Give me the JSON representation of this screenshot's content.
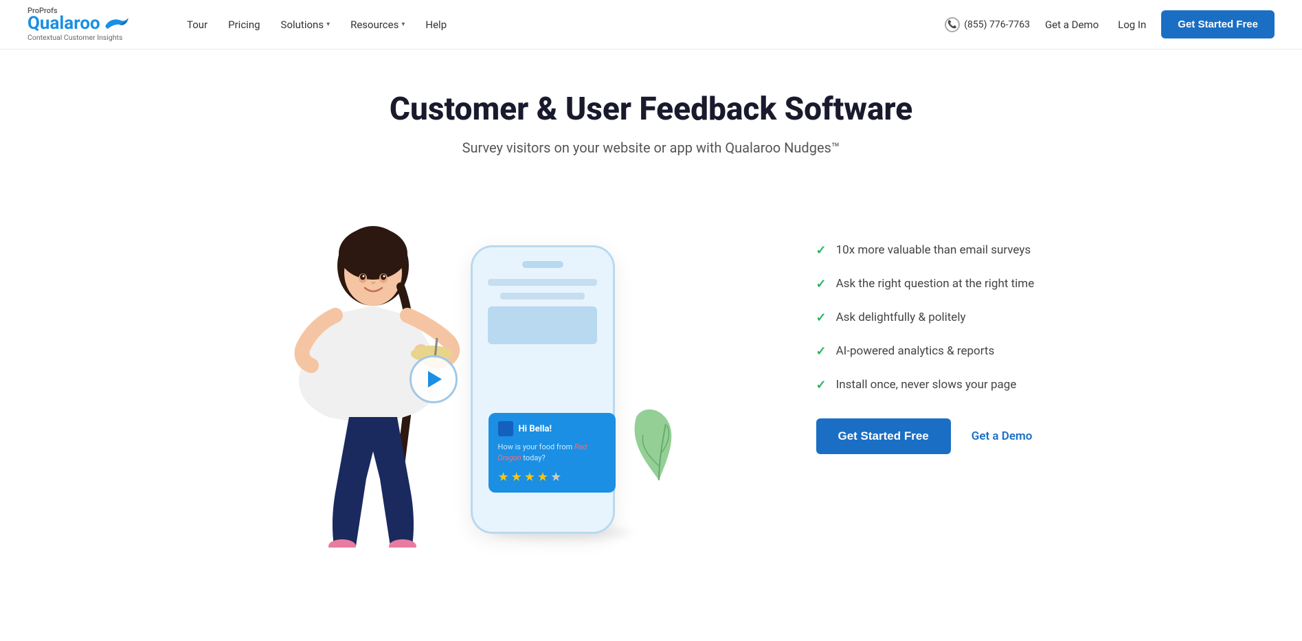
{
  "header": {
    "logo_proprofs": "ProProfs",
    "logo_name": "Qualaroo",
    "logo_tagline": "Contextual Customer Insights",
    "nav": [
      {
        "label": "Tour",
        "has_dropdown": false
      },
      {
        "label": "Pricing",
        "has_dropdown": false
      },
      {
        "label": "Solutions",
        "has_dropdown": true
      },
      {
        "label": "Resources",
        "has_dropdown": true
      },
      {
        "label": "Help",
        "has_dropdown": false
      }
    ],
    "phone": "(855) 776-7763",
    "get_demo_label": "Get a Demo",
    "login_label": "Log In",
    "cta_label": "Get Started Free"
  },
  "hero": {
    "title": "Customer & User Feedback Software",
    "subtitle": "Survey visitors on your website or app with Qualaroo Nudges™",
    "features": [
      {
        "text": "10x more valuable than email surveys"
      },
      {
        "text": "Ask the right question at the right time"
      },
      {
        "text": "Ask delightfully & politely"
      },
      {
        "text": "AI-powered analytics & reports"
      },
      {
        "text": "Install once, never slows your page"
      }
    ],
    "cta_primary": "Get Started Free",
    "cta_secondary": "Get a Demo",
    "nudge": {
      "greeting": "Hi Bella!",
      "question": "How is your food from Red Dragon today?",
      "stars_filled": 4,
      "stars_total": 5
    }
  }
}
